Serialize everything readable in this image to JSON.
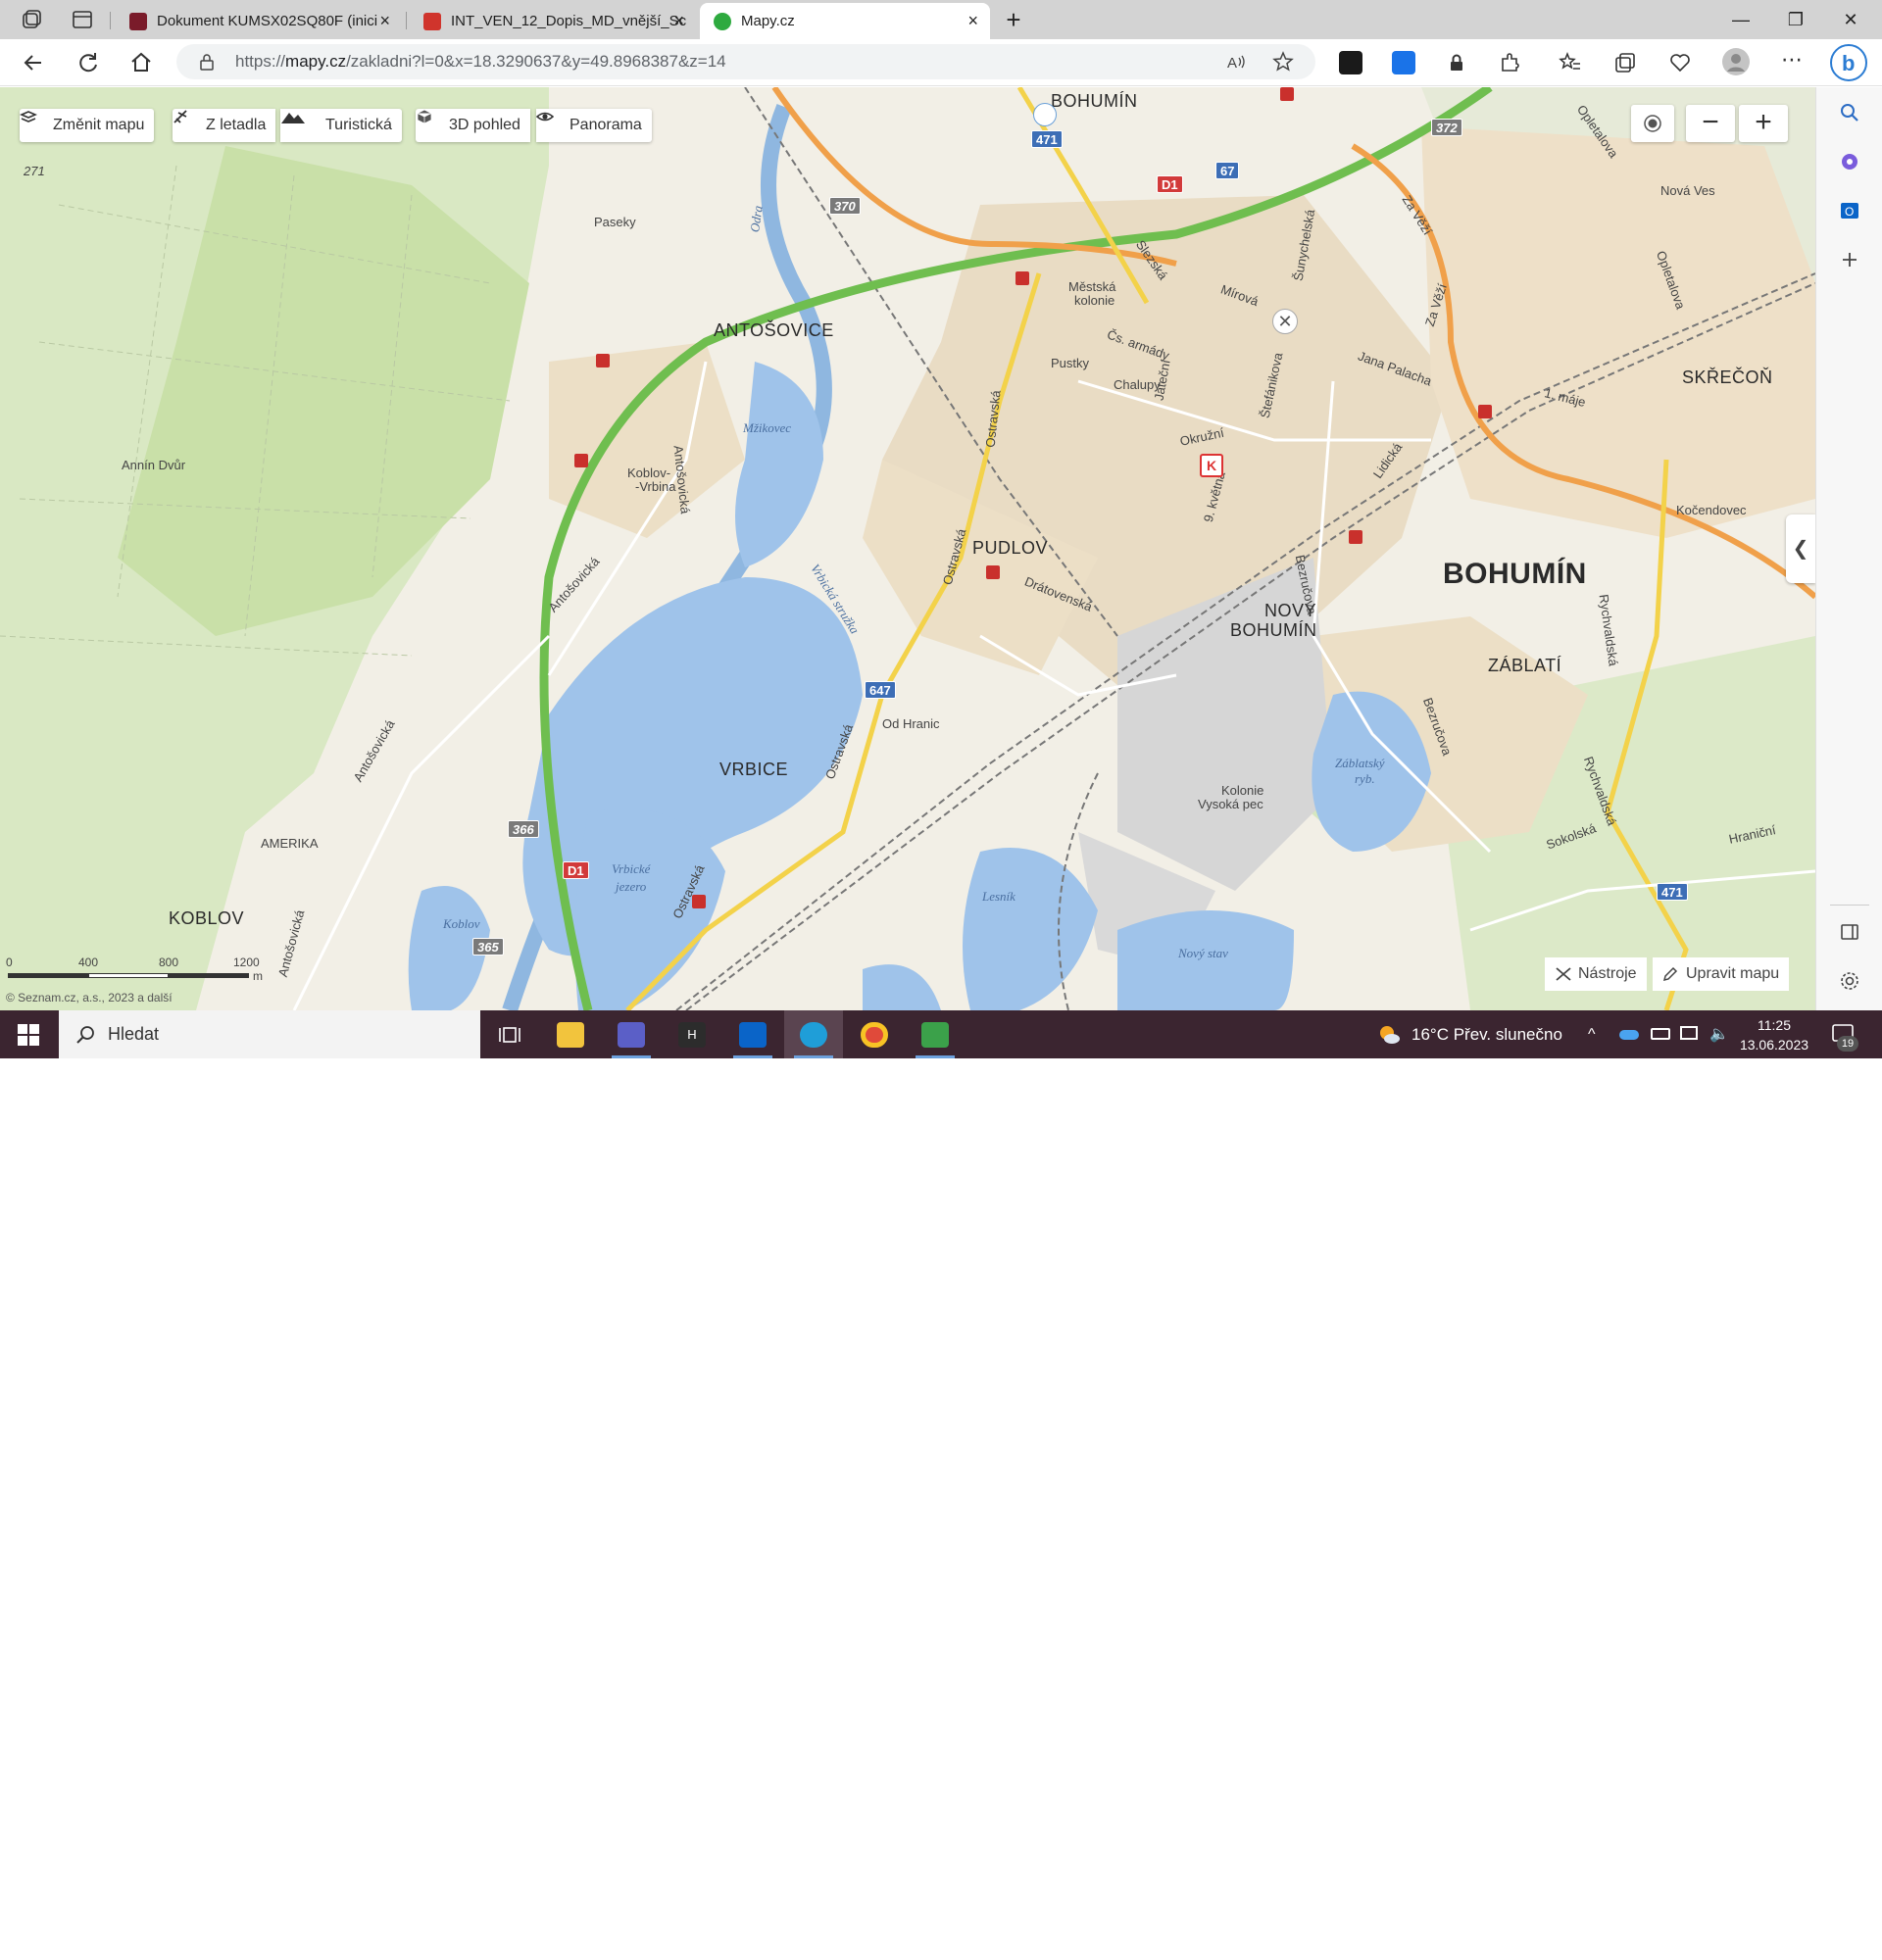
{
  "browser": {
    "tabs": [
      {
        "title": "Dokument KUMSX02SQ80F (inici",
        "close": "×"
      },
      {
        "title": "INT_VEN_12_Dopis_MD_vnější_Sc",
        "close": "×"
      },
      {
        "title": "Mapy.cz",
        "close": "×"
      }
    ],
    "new_tab": "+",
    "window_controls": {
      "minimize": "—",
      "restore": "❐",
      "close": "✕"
    },
    "url_prefix": "https://",
    "url_host": "mapy.cz",
    "url_path": "/zakladni?l=0&x=18.3290637&y=49.8968387&z=14"
  },
  "map": {
    "toolbar": {
      "change_map": "Změnit mapu",
      "aerial": "Z letadla",
      "tourist": "Turistická",
      "view3d": "3D pohled",
      "panorama": "Panorama"
    },
    "zoom_out": "−",
    "zoom_in": "+",
    "towns": {
      "bohumin_big": "BOHUMÍN",
      "stary_bohumin": "BOHUMÍN",
      "antosovice": "ANTOŠOVICE",
      "pudlov": "PUDLOV",
      "vrbice": "VRBICE",
      "novy_bohumin_1": "NOVÝ",
      "novy_bohumin_2": "BOHUMÍN",
      "zablati": "ZÁBLATÍ",
      "skrecon": "SKŘEČOŇ",
      "koblov": "KOBLOV"
    },
    "places": {
      "paseky": "Paseky",
      "annin_dvur": "Annín Dvůr",
      "koblov_vrbina_1": "Koblov-",
      "koblov_vrbina_2": "-Vrbina",
      "mestska_kolonie_1": "Městská",
      "mestska_kolonie_2": "kolonie",
      "pustky": "Pustky",
      "chalupy": "Chalupy",
      "od_hranic": "Od Hranic",
      "amerika": "AMERIKA",
      "kolonie_1": "Kolonie",
      "kolonie_2": "Vysoká pec",
      "nova_ves": "Nová Ves",
      "kocendovec": "Kočendovec",
      "elev_271": "271"
    },
    "streets": {
      "slezska": "Slezská",
      "mirova": "Mírová",
      "cs_armady": "Čs. armády",
      "jateni": "Jateční",
      "stefanikova": "Štefánikova",
      "okruzni": "Okružní",
      "sunychelska": "Šunychelská",
      "jana_palacha": "Jana Palacha",
      "za_vezi_1": "Za Věží",
      "za_vezi_2": "Za Věží",
      "prvni_maje": "1. máje",
      "lidicka": "Lidická",
      "devet_kvetna": "9. května",
      "bezrucova_1": "Bezručova",
      "bezrucova_2": "Bezručova",
      "ostravska_1": "Ostravská",
      "ostravska_2": "Ostravská",
      "ostravska_3": "Ostravská",
      "ostravska_4": "Ostravská",
      "dratovenska": "Drátovenská",
      "antosovicka_1": "Antošovická",
      "antosovicka_2": "Antošovická",
      "antosovicka_3": "Antošovická",
      "antosovicka_4": "Antošovická",
      "oplatova_1": "Opletalova",
      "oplatova_2": "Opletalova",
      "rychvaldska_1": "Rychvaldská",
      "rychvaldska_2": "Rychvaldská",
      "sokolska": "Sokolská",
      "hranicni": "Hraniční",
      "vrbicka_struzka": "Vrbická stružka",
      "odra": "Odra"
    },
    "lakes": {
      "mzikovec": "Mžikovec",
      "vrbicke_1": "Vrbické",
      "vrbicke_2": "jezero",
      "koblov": "Koblov",
      "lesnik": "Lesník",
      "novy_stav": "Nový stav",
      "zablatsky_1": "Záblatský",
      "zablatsky_2": "ryb."
    },
    "shields": {
      "d1_a": "D1",
      "d1_b": "D1",
      "r67": "67",
      "r471_a": "471",
      "r471_b": "471",
      "r647": "647",
      "r370": "370",
      "r372": "372",
      "r366": "366",
      "r365": "365"
    },
    "scale": {
      "s0": "0",
      "s400": "400",
      "s800": "800",
      "s1200": "1200",
      "unit": "m"
    },
    "copyright": "© Seznam.cz, a.s., 2023 a další",
    "tools": "Nástroje",
    "edit_map": "Upravit mapu",
    "collapse": "❮"
  },
  "taskbar": {
    "search_label": "Hledat",
    "weather": "16°C  Přev. slunečno",
    "time": "11:25",
    "date": "13.06.2023",
    "notifications": "19"
  }
}
